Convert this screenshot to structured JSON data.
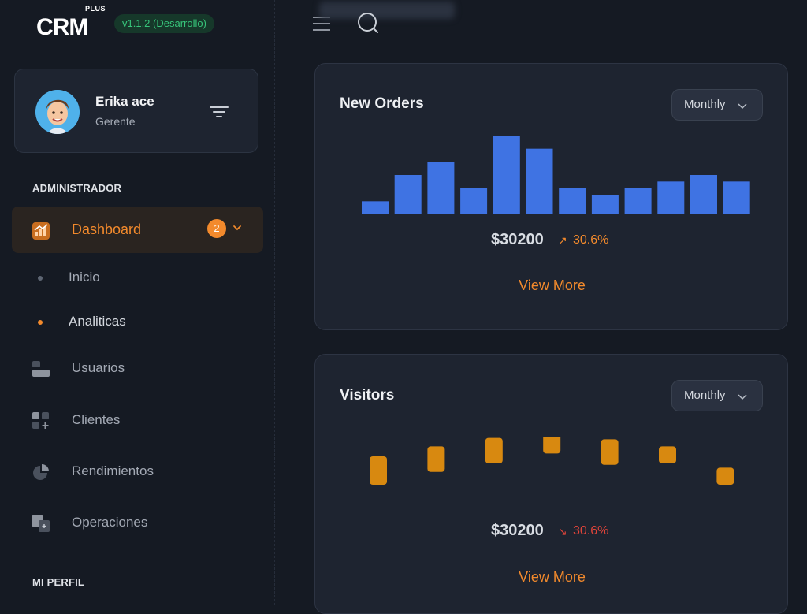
{
  "app": {
    "logo_text": "CRM",
    "logo_superscript": "PLUS",
    "version": "v1.1.2 (Desarrollo)"
  },
  "profile": {
    "name": "Erika ace",
    "role": "Gerente"
  },
  "sidebar": {
    "section_admin": "ADMINISTRADOR",
    "dashboard": {
      "label": "Dashboard",
      "badge": "2"
    },
    "subitems": [
      {
        "label": "Inicio",
        "active": false
      },
      {
        "label": "Analiticas",
        "active": true
      }
    ],
    "items": [
      {
        "label": "Usuarios",
        "icon": "users-icon"
      },
      {
        "label": "Clientes",
        "icon": "clients-icon"
      },
      {
        "label": "Rendimientos",
        "icon": "pie-chart-icon"
      },
      {
        "label": "Operaciones",
        "icon": "operations-icon"
      }
    ],
    "section_profile": "MI PERFIL"
  },
  "colors": {
    "accent": "#f38a2c",
    "bar_blue": "#3f73e3",
    "visitor_orange": "#d88910",
    "up_trend": "#f38a2c",
    "down_trend": "#e0443a",
    "version_green": "#37c47a"
  },
  "orders_card": {
    "title": "New Orders",
    "period": "Monthly",
    "value": "$30200",
    "change": "30.6%",
    "trend": "up",
    "trend_symbol": "↗",
    "view_more": "View More"
  },
  "visitors_card": {
    "title": "Visitors",
    "period": "Monthly",
    "value": "$30200",
    "change": "30.6%",
    "trend": "down",
    "trend_symbol": "↘",
    "view_more": "View More"
  },
  "chart_data": [
    {
      "type": "bar",
      "title": "New Orders",
      "values": [
        2,
        6,
        8,
        4,
        12,
        10,
        4,
        3,
        4,
        5,
        6,
        5
      ],
      "ylim": [
        0,
        12
      ],
      "grid": false
    },
    {
      "type": "bar",
      "title": "Visitors",
      "ranges": [
        [
          1,
          5
        ],
        [
          2.8,
          6.4
        ],
        [
          4,
          7.6
        ],
        [
          5.4,
          8.6
        ],
        [
          3.8,
          7.4
        ],
        [
          4,
          6.4
        ],
        [
          1,
          3.4
        ]
      ],
      "ylim": [
        0,
        8.6
      ],
      "grid": false
    }
  ]
}
